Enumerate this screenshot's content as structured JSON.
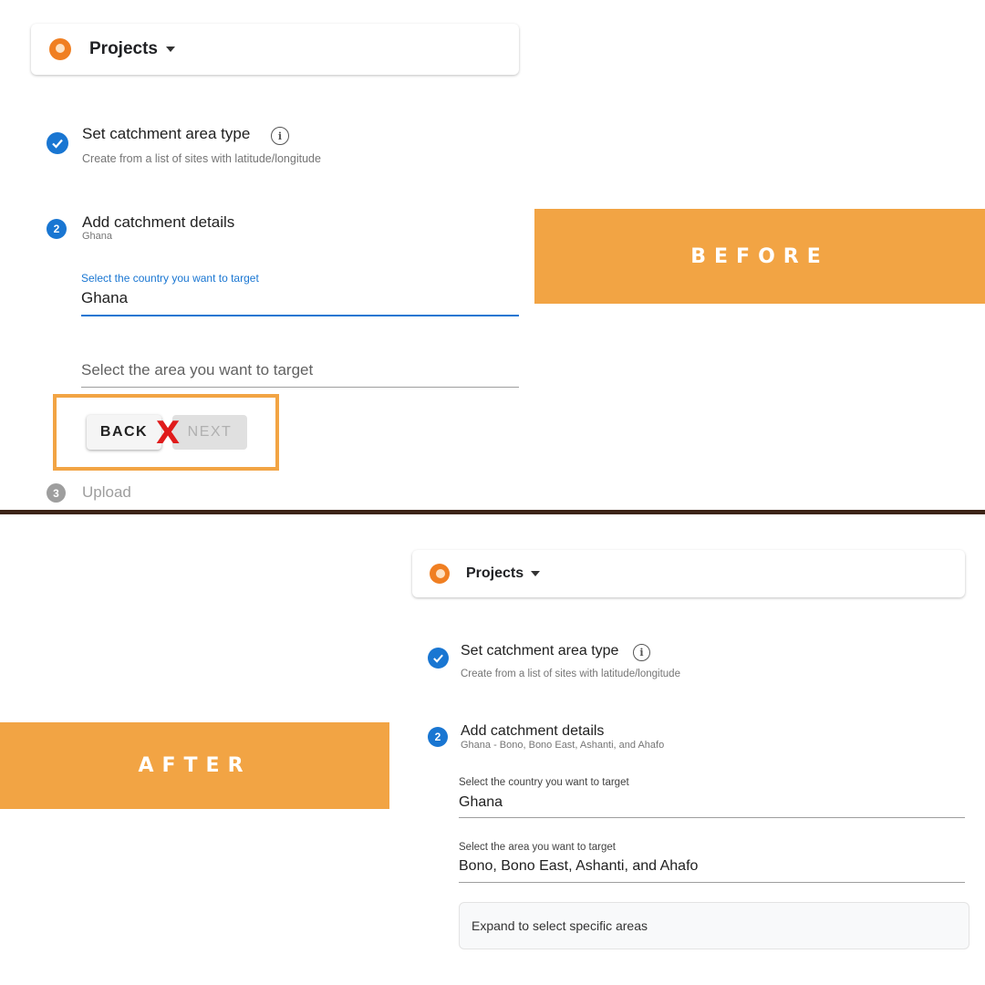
{
  "before": {
    "app_menu_label": "Projects",
    "step1": {
      "title": "Set catchment area type",
      "subtitle": "Create from a list of sites with latitude/longitude"
    },
    "step2": {
      "number": "2",
      "title": "Add catchment details",
      "subtitle": "Ghana"
    },
    "country_field": {
      "label": "Select the country you want to target",
      "value": "Ghana"
    },
    "area_field": {
      "placeholder": "Select the area you want to target"
    },
    "back_label": "BACK",
    "next_label": "NEXT",
    "error_mark": "X",
    "step3": {
      "number": "3",
      "title": "Upload"
    },
    "banner": "BEFORE"
  },
  "after": {
    "app_menu_label": "Projects",
    "step1": {
      "title": "Set catchment area type",
      "subtitle": "Create from a list of sites with latitude/longitude"
    },
    "step2": {
      "number": "2",
      "title": "Add catchment details",
      "subtitle": "Ghana - Bono, Bono East, Ashanti, and Ahafo"
    },
    "country_field": {
      "label": "Select the country you want to target",
      "value": "Ghana"
    },
    "area_field": {
      "label": "Select the area you want to target",
      "value": "Bono, Bono East, Ashanti, and Ahafo"
    },
    "expand_label": "Expand to select specific areas",
    "banner": "AFTER"
  },
  "colors": {
    "accent": "#f2a444",
    "primary": "#1976d2",
    "logo": "#f07f22",
    "error": "#e01b1b",
    "divider": "#3d2417"
  },
  "icons": [
    "logo-icon",
    "caret-down-icon",
    "check-icon",
    "info-icon"
  ]
}
